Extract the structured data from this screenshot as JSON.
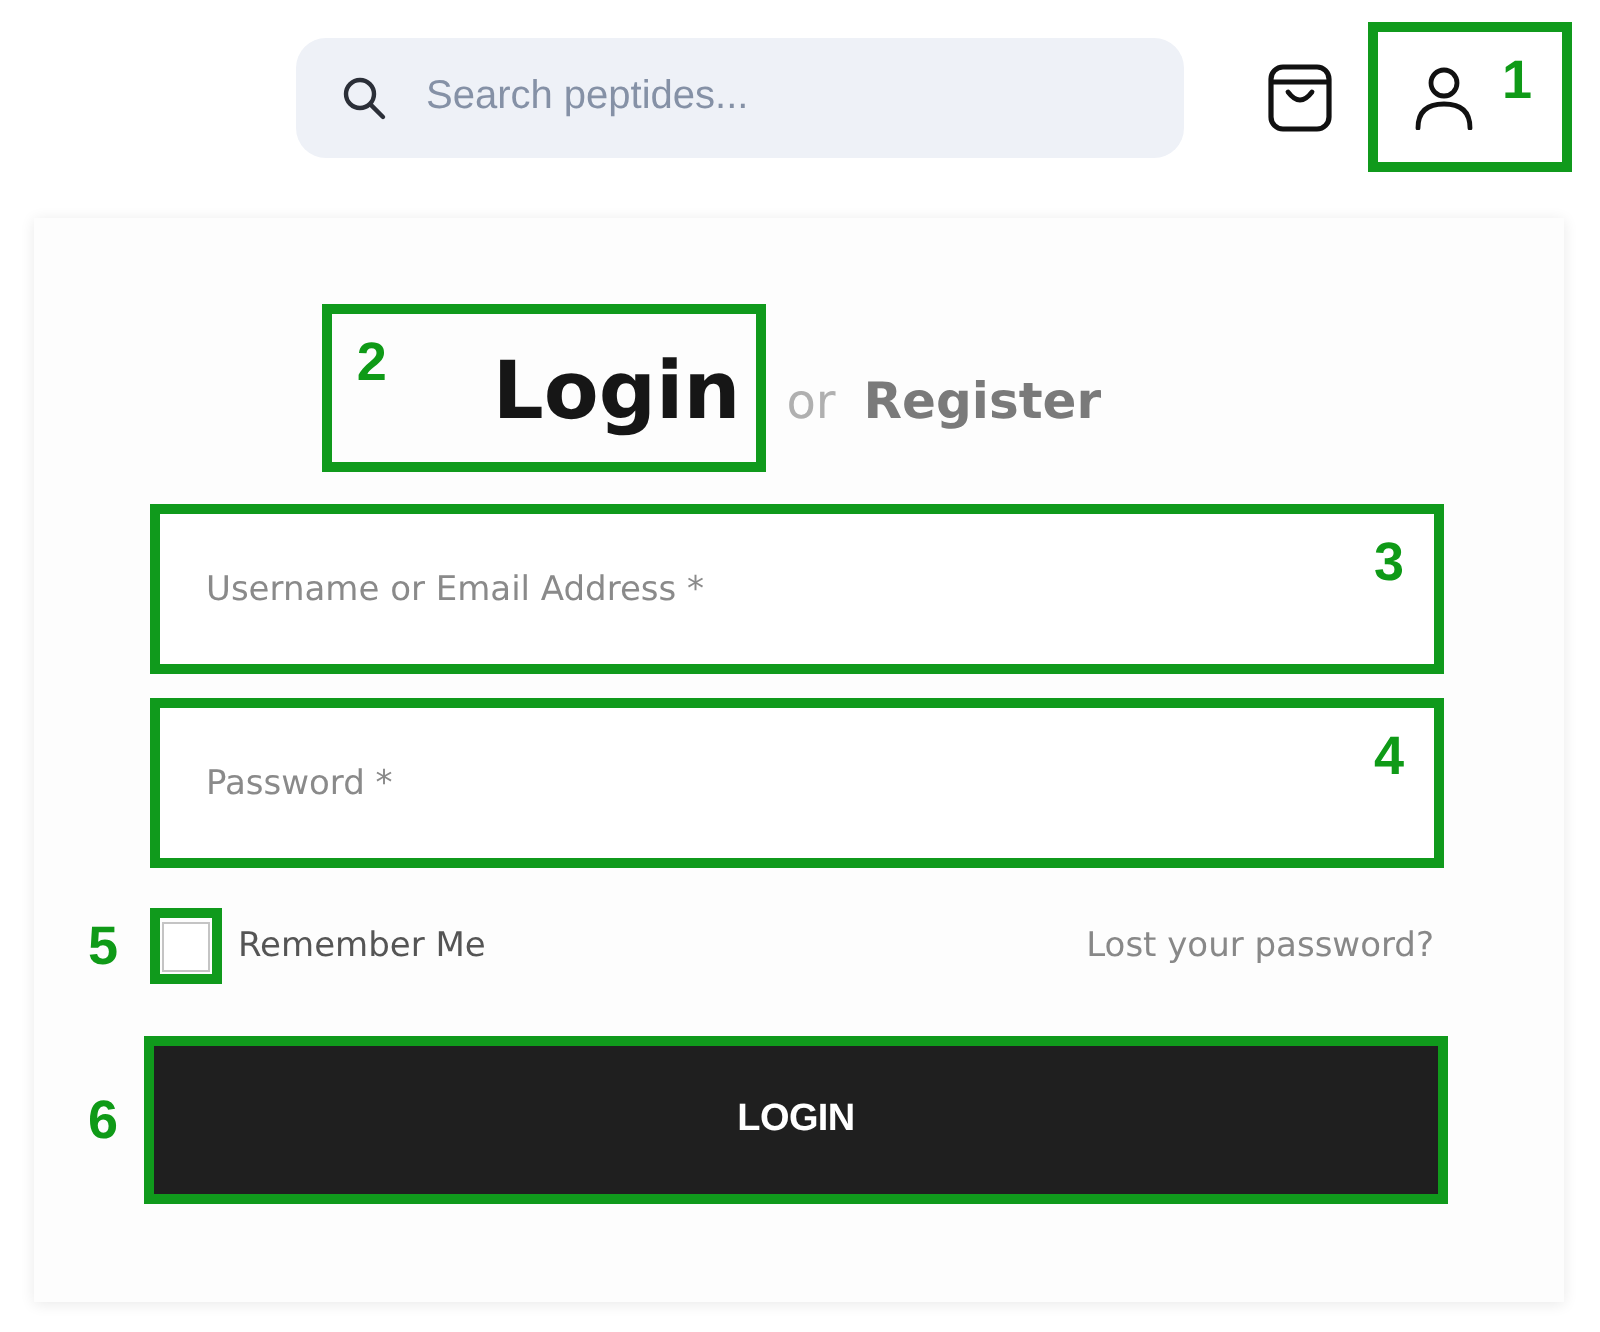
{
  "header": {
    "search": {
      "placeholder": "Search peptides..."
    },
    "account": {
      "marker": "1"
    }
  },
  "form": {
    "title": "Login",
    "title_marker": "2",
    "separator": "or",
    "register_link": "Register",
    "fields": [
      {
        "placeholder": "Username or Email Address *",
        "marker": "3"
      },
      {
        "placeholder": "Password *",
        "marker": "4"
      }
    ],
    "remember": {
      "label": "Remember Me",
      "checked": false,
      "marker": "5"
    },
    "lost_password_link": "Lost your password?",
    "submit": {
      "label": "LOGIN",
      "marker": "6"
    }
  }
}
